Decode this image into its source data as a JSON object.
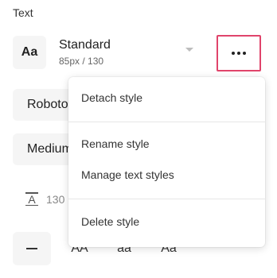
{
  "section": {
    "title": "Text"
  },
  "style": {
    "icon_label": "Aa",
    "name": "Standard",
    "meta": "85px / 130"
  },
  "fields": {
    "font": "Roboto",
    "weight": "Medium"
  },
  "line_height": {
    "value": "130"
  },
  "case_options": {
    "upper": "AA",
    "lower": "aa",
    "title": "Aa"
  },
  "menu": {
    "items": [
      "Detach style",
      "Rename style",
      "Manage text styles",
      "Delete style"
    ]
  },
  "colors": {
    "highlight": "#e0446b"
  }
}
